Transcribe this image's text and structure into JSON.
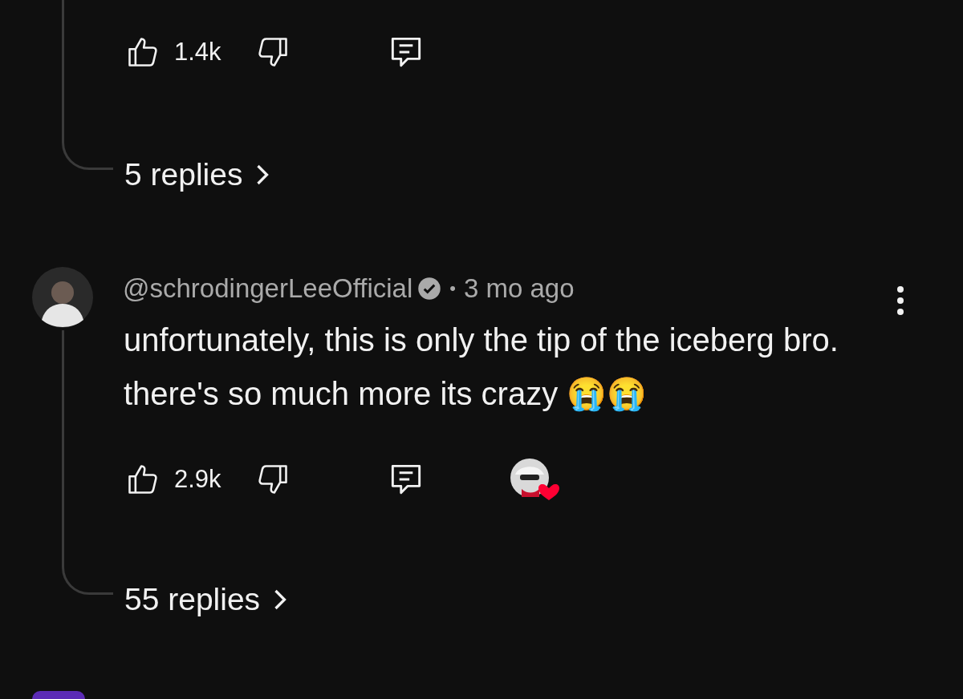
{
  "previous_comment": {
    "likes": "1.4k",
    "replies": "5 replies"
  },
  "comment": {
    "handle": "@schrodingerLeeOfficial",
    "verified": true,
    "separator": "•",
    "time": "3 mo ago",
    "text": "unfortunately, this is only the tip of the iceberg bro. there's so much more its crazy 😭😭",
    "likes": "2.9k",
    "creator_heart": true,
    "replies": "55 replies"
  }
}
